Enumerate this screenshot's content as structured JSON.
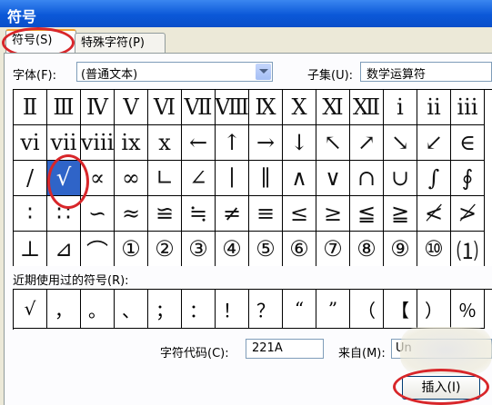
{
  "window": {
    "title": "符号"
  },
  "tabs": [
    {
      "label": "符号(S)",
      "active": true
    },
    {
      "label": "特殊字符(P)",
      "active": false
    }
  ],
  "font": {
    "label": "字体(F):",
    "value": "(普通文本)"
  },
  "subset": {
    "label": "子集(U):",
    "value": "数学运算符"
  },
  "symbols": [
    [
      "Ⅱ",
      "Ⅲ",
      "Ⅳ",
      "Ⅴ",
      "Ⅵ",
      "Ⅶ",
      "Ⅷ",
      "Ⅸ",
      "Ⅹ",
      "Ⅺ",
      "Ⅻ",
      "ⅰ",
      "ⅱ",
      "ⅲ"
    ],
    [
      "ⅵ",
      "ⅶ",
      "ⅷ",
      "ⅸ",
      "ⅹ",
      "←",
      "↑",
      "→",
      "↓",
      "↖",
      "↗",
      "↘",
      "↙",
      "∈"
    ],
    [
      "/",
      "√",
      "∝",
      "∞",
      "∟",
      "∠",
      "∣",
      "∥",
      "∧",
      "∨",
      "∩",
      "∪",
      "∫",
      "∮"
    ],
    [
      "∶",
      "∷",
      "∽",
      "≈",
      "≌",
      "≒",
      "≠",
      "≡",
      "≤",
      "≥",
      "≦",
      "≧",
      "≮",
      "≯"
    ],
    [
      "⊥",
      "⊿",
      "⌒",
      "①",
      "②",
      "③",
      "④",
      "⑤",
      "⑥",
      "⑦",
      "⑧",
      "⑨",
      "⑩",
      "⑴"
    ]
  ],
  "selected_symbol": "√",
  "recent": {
    "label": "近期使用过的符号(R):",
    "items": [
      "√",
      "，",
      "。",
      "、",
      "；",
      "：",
      "！",
      "？",
      "“",
      "”",
      "（",
      "【",
      "）",
      "％"
    ]
  },
  "char_code": {
    "label": "字符代码(C):",
    "value": "221A"
  },
  "from": {
    "label": "来自(M):",
    "value": "Un"
  },
  "insert_button": {
    "label": "插入(I)"
  },
  "colors": {
    "highlight": "#d8262a",
    "selection": "#2f64c8",
    "titlebar": "#0b58d8"
  }
}
